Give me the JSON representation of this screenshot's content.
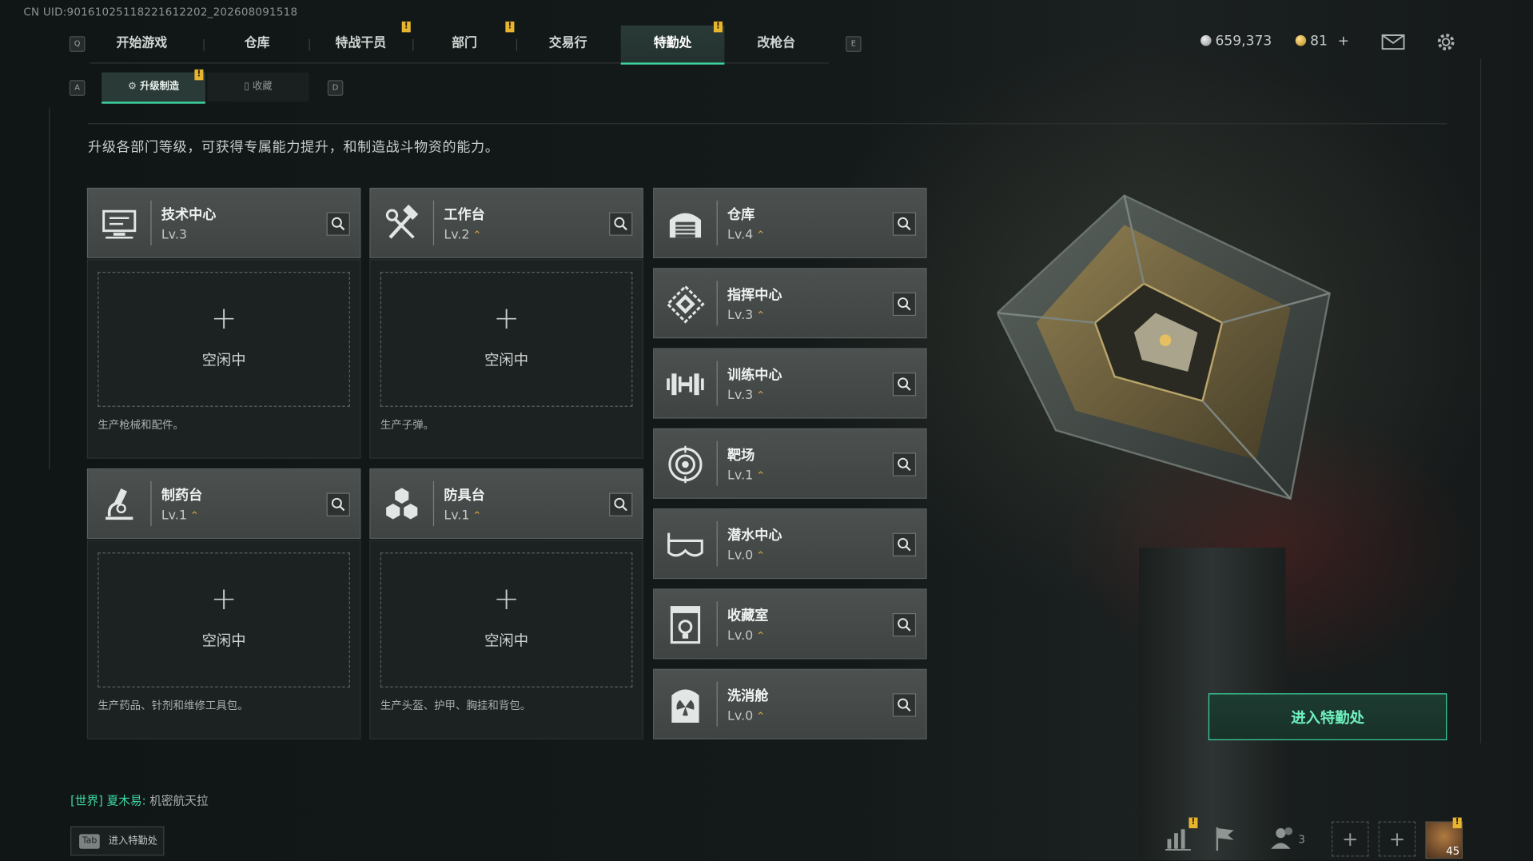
{
  "uid_text": "CN UID:9016102511822161220​2_202608091518",
  "nav": {
    "tabs": [
      {
        "label": "开始游戏"
      },
      {
        "label": "仓库"
      },
      {
        "label": "特战干员"
      },
      {
        "label": "部门"
      },
      {
        "label": "交易行"
      },
      {
        "label": "特勤处"
      },
      {
        "label": "改枪台"
      }
    ],
    "active_tab": "特勤处",
    "key_left": "Q",
    "key_right": "E"
  },
  "subnav": {
    "tabs": [
      {
        "label": "升级制造"
      },
      {
        "label": "收藏"
      }
    ],
    "key_left": "A",
    "key_right": "D"
  },
  "currency": {
    "hafcoin": "659,373",
    "tokens": "81",
    "plus": "+"
  },
  "description": "升级各部门等级，可获得专属能力提升，和制造战斗物资的能力。",
  "production_stations": [
    {
      "name": "技术中心",
      "level": "Lv.3",
      "upgradeable": false,
      "slot_plus": "+",
      "slot_status": "空闲中",
      "desc": "生产枪械和配件。",
      "icon": "computer-icon"
    },
    {
      "name": "工作台",
      "level": "Lv.2",
      "upgradeable": true,
      "slot_plus": "+",
      "slot_status": "空闲中",
      "desc": "生产子弹。",
      "icon": "tools-icon"
    },
    {
      "name": "制药台",
      "level": "Lv.1",
      "upgradeable": true,
      "slot_plus": "+",
      "slot_status": "空闲中",
      "desc": "生产药品、针剂和维修工具包。",
      "icon": "microscope-icon"
    },
    {
      "name": "防具台",
      "level": "Lv.1",
      "upgradeable": true,
      "slot_plus": "+",
      "slot_status": "空闲中",
      "desc": "生产头盔、护甲、胸挂和背包。",
      "icon": "hexagons-icon"
    }
  ],
  "facilities": [
    {
      "name": "仓库",
      "level": "Lv.4",
      "icon": "warehouse-icon"
    },
    {
      "name": "指挥中心",
      "level": "Lv.3",
      "icon": "command-icon"
    },
    {
      "name": "训练中心",
      "level": "Lv.3",
      "icon": "dumbbell-icon"
    },
    {
      "name": "靶场",
      "level": "Lv.1",
      "icon": "target-icon"
    },
    {
      "name": "潜水中心",
      "level": "Lv.0",
      "icon": "diving-mask-icon"
    },
    {
      "name": "收藏室",
      "level": "Lv.0",
      "icon": "collection-icon"
    },
    {
      "name": "洗消舱",
      "level": "Lv.0",
      "icon": "radiation-icon"
    }
  ],
  "enter_button": "进入特勤处",
  "chat": {
    "channel": "[世界]",
    "sender": "夏木易:",
    "message": "机密航天拉"
  },
  "tab_hint": {
    "key": "Tab",
    "label": "进入特勤处"
  },
  "bottom_bar": {
    "friends_count": "3",
    "player_level": "45"
  },
  "colors": {
    "accent": "#3dd6a0",
    "badge": "#e8b530",
    "upgrade_chevron": "#d9a53a",
    "card_bg": "#474c4b"
  }
}
